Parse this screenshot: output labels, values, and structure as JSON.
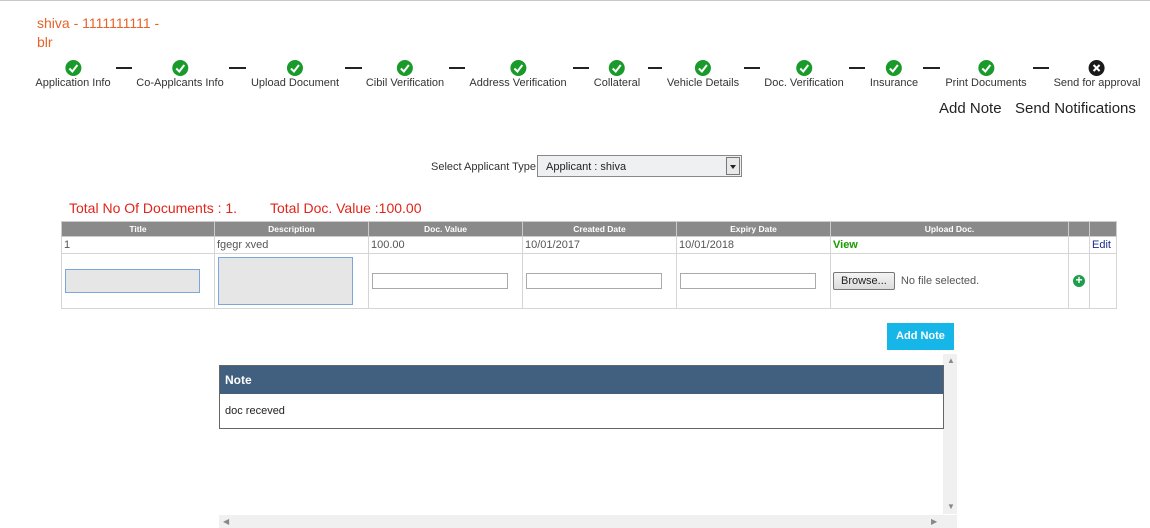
{
  "customer": {
    "line1": "shiva - 1111111111 -",
    "line2": "blr"
  },
  "steps": [
    {
      "label": "Application Info",
      "status": "done"
    },
    {
      "label": "Co-Applcants Info",
      "status": "done"
    },
    {
      "label": "Upload Document",
      "status": "done"
    },
    {
      "label": "Cibil Verification",
      "status": "done"
    },
    {
      "label": "Address Verification",
      "status": "done"
    },
    {
      "label": "Collateral",
      "status": "done"
    },
    {
      "label": "Vehicle Details",
      "status": "done"
    },
    {
      "label": "Doc. Verification",
      "status": "done"
    },
    {
      "label": "Insurance",
      "status": "done"
    },
    {
      "label": "Print Documents",
      "status": "done"
    },
    {
      "label": "Send for approval",
      "status": "pending"
    }
  ],
  "actions": {
    "add_note": "Add Note",
    "send_notifications": "Send Notifications"
  },
  "applicant_type": {
    "label": "Select Applicant Type",
    "selected": "Applicant : shiva"
  },
  "summary": {
    "total_docs": "Total No Of Documents : 1.",
    "total_value": "Total Doc. Value :100.00"
  },
  "table": {
    "headers": [
      "Title",
      "Description",
      "Doc. Value",
      "Created Date",
      "Expiry Date",
      "Upload Doc.",
      "",
      ""
    ],
    "rows": [
      {
        "title": "1",
        "description": "fgegr xved",
        "value": "100.00",
        "created": "10/01/2017",
        "expiry": "10/01/2018",
        "upload": "View",
        "edit": "Edit"
      }
    ],
    "new_row": {
      "browse_label": "Browse...",
      "file_status": "No file selected."
    }
  },
  "note_section": {
    "button": "Add Note",
    "header": "Note",
    "text": "doc receved"
  },
  "colors": {
    "accent": "#e8622a",
    "red": "#e0251b",
    "done": "#1a9a2a",
    "pending": "#1a1a1a",
    "note_header": "#415f7e",
    "button": "#16b6e8"
  }
}
